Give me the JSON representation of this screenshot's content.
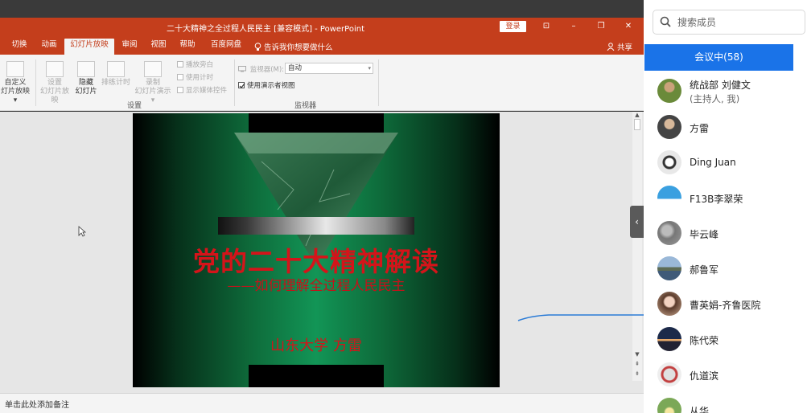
{
  "window": {
    "title": "二十大精神之全过程人民民主 [兼容模式]  -  PowerPoint",
    "login_label": "登录",
    "ctrl_ribbon": "⊡",
    "ctrl_minimize": "–",
    "ctrl_restore": "❐",
    "ctrl_close": "✕"
  },
  "tabs": [
    {
      "label": "切换"
    },
    {
      "label": "动画"
    },
    {
      "label": "幻灯片放映"
    },
    {
      "label": "审阅"
    },
    {
      "label": "视图"
    },
    {
      "label": "帮助"
    },
    {
      "label": "百度网盘"
    }
  ],
  "tell_me": "告诉我你想要做什么",
  "share_label": "共享",
  "ribbon": {
    "custom_show_line1": "自定义",
    "custom_show_line2": "灯片放映 ▾",
    "setup_show_line1": "设置",
    "setup_show_line2": "幻灯片放映",
    "hide_slide_line1": "隐藏",
    "hide_slide_line2": "幻灯片",
    "rehearse": "排练计时",
    "record_line1": "录制",
    "record_line2": "幻灯片演示 ▾",
    "check_narration": "播放旁白",
    "check_timings": "使用计时",
    "check_media": "显示媒体控件",
    "group_setup": "设置",
    "monitor_label": "监视器(M):",
    "monitor_value": "自动",
    "presenter_view": "使用演示者视图",
    "group_monitor": "监视器"
  },
  "slide": {
    "title": "党的二十大精神解读",
    "subtitle": "——如何理解全过程人民民主",
    "author": "山东大学  方雷"
  },
  "notes_placeholder": "单击此处添加备注",
  "panel": {
    "search_placeholder": "搜索成员",
    "meeting_label": "会议中(58)",
    "members": [
      {
        "name": "统战部 刘健文",
        "role": "(主持人, 我)"
      },
      {
        "name": "方雷"
      },
      {
        "name": "Ding Juan"
      },
      {
        "name": "F13B李翠荣"
      },
      {
        "name": "毕云峰"
      },
      {
        "name": "郝鲁军"
      },
      {
        "name": "曹英娟-齐鲁医院"
      },
      {
        "name": "陈代荣"
      },
      {
        "name": "仇道滨"
      },
      {
        "name": "从华"
      }
    ]
  },
  "colors": {
    "ppt_red": "#c43e1c",
    "meeting_blue": "#1a73e8",
    "slide_text_red": "#d4141a"
  }
}
